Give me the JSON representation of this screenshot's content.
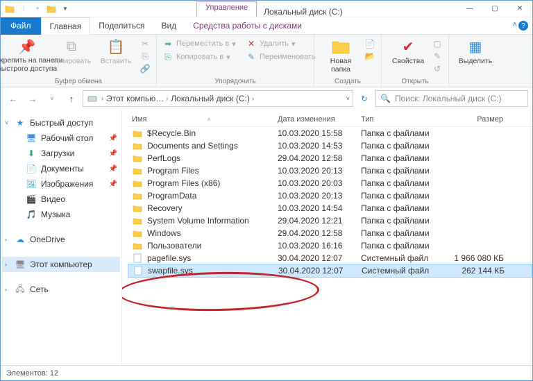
{
  "window": {
    "title": "Локальный диск (C:)",
    "mgmt_label": "Управление",
    "min": "—",
    "max": "▢",
    "close": "✕"
  },
  "tabs": {
    "file": "Файл",
    "home": "Главная",
    "share": "Поделиться",
    "view": "Вид",
    "ctx": "Средства работы с дисками"
  },
  "ribbon": {
    "pin": "Закрепить на панели быстрого доступа",
    "copy": "Копировать",
    "paste": "Вставить",
    "g_clip": "Буфер обмена",
    "move": "Переместить в",
    "copyto": "Копировать в",
    "delete": "Удалить",
    "rename": "Переименовать",
    "g_org": "Упорядочить",
    "newfolder": "Новая папка",
    "g_new": "Создать",
    "props": "Свойства",
    "g_open": "Открыть",
    "selectall": "Выделить",
    "g_select": ""
  },
  "nav": {
    "pc": "Этот компью…",
    "drive": "Локальный диск (C:)",
    "search_ph": "Поиск: Локальный диск (C:)"
  },
  "sidebar": {
    "quick": "Быстрый доступ",
    "items": [
      {
        "label": "Рабочий стол"
      },
      {
        "label": "Загрузки"
      },
      {
        "label": "Документы"
      },
      {
        "label": "Изображения"
      },
      {
        "label": "Видео"
      },
      {
        "label": "Музыка"
      }
    ],
    "onedrive": "OneDrive",
    "thispc": "Этот компьютер",
    "network": "Сеть"
  },
  "cols": {
    "name": "Имя",
    "date": "Дата изменения",
    "type": "Тип",
    "size": "Размер"
  },
  "files": [
    {
      "name": "$Recycle.Bin",
      "date": "10.03.2020 15:58",
      "type": "Папка с файлами",
      "size": "",
      "kind": "folder"
    },
    {
      "name": "Documents and Settings",
      "date": "10.03.2020 14:53",
      "type": "Папка с файлами",
      "size": "",
      "kind": "folder"
    },
    {
      "name": "PerfLogs",
      "date": "29.04.2020 12:58",
      "type": "Папка с файлами",
      "size": "",
      "kind": "folder"
    },
    {
      "name": "Program Files",
      "date": "10.03.2020 20:13",
      "type": "Папка с файлами",
      "size": "",
      "kind": "folder"
    },
    {
      "name": "Program Files (x86)",
      "date": "10.03.2020 20:03",
      "type": "Папка с файлами",
      "size": "",
      "kind": "folder"
    },
    {
      "name": "ProgramData",
      "date": "10.03.2020 20:13",
      "type": "Папка с файлами",
      "size": "",
      "kind": "folder"
    },
    {
      "name": "Recovery",
      "date": "10.03.2020 14:54",
      "type": "Папка с файлами",
      "size": "",
      "kind": "folder"
    },
    {
      "name": "System Volume Information",
      "date": "29.04.2020 12:21",
      "type": "Папка с файлами",
      "size": "",
      "kind": "folder"
    },
    {
      "name": "Windows",
      "date": "29.04.2020 12:58",
      "type": "Папка с файлами",
      "size": "",
      "kind": "folder"
    },
    {
      "name": "Пользователи",
      "date": "10.03.2020 16:16",
      "type": "Папка с файлами",
      "size": "",
      "kind": "folder"
    },
    {
      "name": "pagefile.sys",
      "date": "30.04.2020 12:07",
      "type": "Системный файл",
      "size": "1 966 080 КБ",
      "kind": "file"
    },
    {
      "name": "swapfile.sys",
      "date": "30.04.2020 12:07",
      "type": "Системный файл",
      "size": "262 144 КБ",
      "kind": "file",
      "sel": true
    }
  ],
  "status": {
    "count": "Элементов: 12"
  }
}
